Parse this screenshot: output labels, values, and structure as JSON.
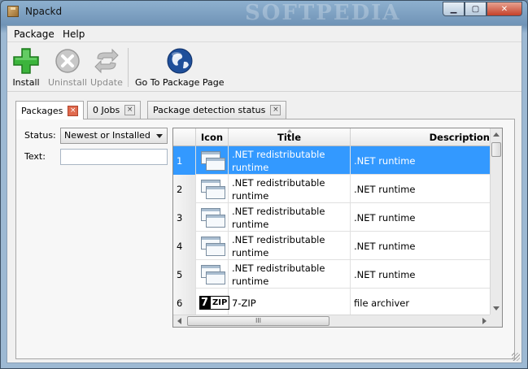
{
  "window": {
    "title": "Npackd",
    "watermark": "SOFTPEDIA"
  },
  "menubar": {
    "items": [
      "Package",
      "Help"
    ]
  },
  "toolbar": {
    "install": "Install",
    "uninstall": "Uninstall",
    "update": "Update",
    "goto_page": "Go To Package Page"
  },
  "tabs": [
    {
      "label": "Packages",
      "close": "×"
    },
    {
      "label": "0 Jobs",
      "close": "×"
    },
    {
      "label": "Package detection status",
      "close": "×"
    }
  ],
  "filters": {
    "status_label": "Status:",
    "status_value": "Newest or Installed",
    "text_label": "Text:",
    "text_value": ""
  },
  "grid": {
    "columns": [
      "Icon",
      "Title",
      "Description"
    ],
    "rows": [
      {
        "num": "1",
        "icon": "windows-app-icon",
        "title": ".NET redistributable runtime",
        "description": ".NET runtime",
        "selected": true
      },
      {
        "num": "2",
        "icon": "windows-app-icon",
        "title": ".NET redistributable runtime",
        "description": ".NET runtime",
        "selected": false
      },
      {
        "num": "3",
        "icon": "windows-app-icon",
        "title": ".NET redistributable runtime",
        "description": ".NET runtime",
        "selected": false
      },
      {
        "num": "4",
        "icon": "windows-app-icon",
        "title": ".NET redistributable runtime",
        "description": ".NET runtime",
        "selected": false
      },
      {
        "num": "5",
        "icon": "windows-app-icon",
        "title": ".NET redistributable runtime",
        "description": ".NET runtime",
        "selected": false
      },
      {
        "num": "6",
        "icon": "7zip-icon",
        "icon_text_a": "7",
        "icon_text_b": "ZIP",
        "title": "7-ZIP",
        "description": "file archiver",
        "selected": false
      }
    ],
    "hscroll_thumb": "III"
  },
  "colors": {
    "selection": "#3399ff",
    "install_green": "#2fa82f",
    "close_red": "#c4412a"
  }
}
